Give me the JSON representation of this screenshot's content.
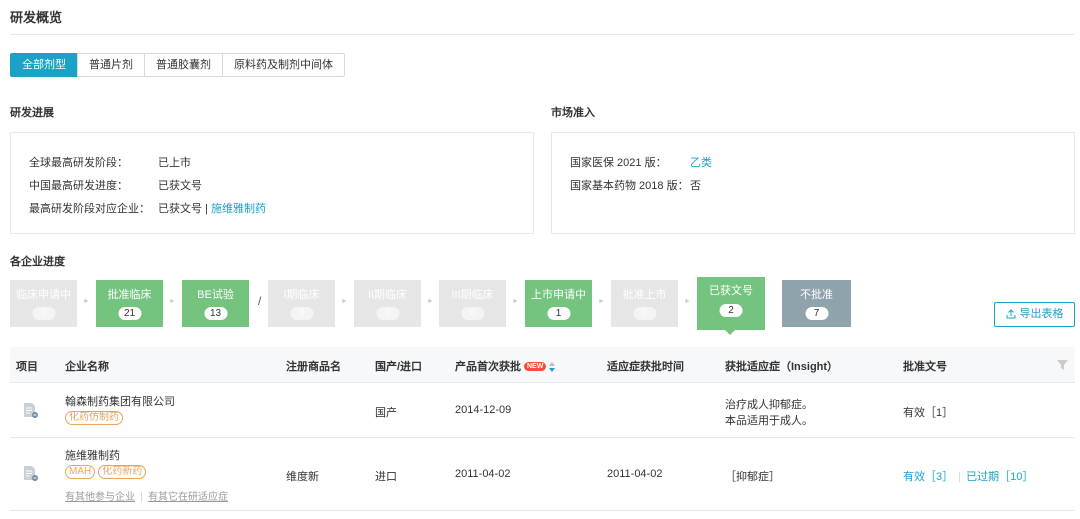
{
  "page": {
    "title": "研发概览"
  },
  "tabs": [
    {
      "label": "全部剂型",
      "active": true
    },
    {
      "label": "普通片剂",
      "active": false
    },
    {
      "label": "普通胶囊剂",
      "active": false
    },
    {
      "label": "原料药及制剂中间体",
      "active": false
    }
  ],
  "rd_progress": {
    "title": "研发进展",
    "rows": [
      {
        "key": "全球最高研发阶段：",
        "value": "已上市"
      },
      {
        "key": "中国最高研发进度：",
        "value": "已获文号"
      },
      {
        "key": "最高研发阶段对应企业：",
        "value": "已获文号 | ",
        "link": "施维雅制药"
      }
    ]
  },
  "market_access": {
    "title": "市场准入",
    "rows": [
      {
        "key": "国家医保 2021 版：",
        "value": "乙类"
      },
      {
        "key": "国家基本药物 2018 版：",
        "value": "否"
      }
    ]
  },
  "company_progress": {
    "title": "各企业进度",
    "stages": [
      {
        "label": "临床申请中",
        "count": "0",
        "style": "gray"
      },
      {
        "label": "批准临床",
        "count": "21",
        "style": "green"
      },
      {
        "label": "BE试验",
        "count": "13",
        "style": "green"
      },
      {
        "label": "I期临床",
        "count": "0",
        "style": "gray"
      },
      {
        "label": "II期临床",
        "count": "0",
        "style": "gray"
      },
      {
        "label": "III期临床",
        "count": "0",
        "style": "gray"
      },
      {
        "label": "上市申请中",
        "count": "1",
        "style": "green"
      },
      {
        "label": "批准上市",
        "count": "0",
        "style": "gray"
      },
      {
        "label": "已获文号",
        "count": "2",
        "style": "green"
      },
      {
        "label": "不批准",
        "count": "7",
        "style": "slate"
      }
    ],
    "separator": "/",
    "export_label": "导出表格"
  },
  "table": {
    "headers": {
      "item": "项目",
      "company": "企业名称",
      "brand": "注册商品名",
      "origin": "国产/进口",
      "first_approval": "产品首次获批",
      "new_badge": "NEW",
      "indication_date": "适应症获批时间",
      "indication": "获批适应症（Insight）",
      "approval_no": "批准文号"
    },
    "rows": [
      {
        "company": "翰森制药集团有限公司",
        "tags": [
          "化药仿制药"
        ],
        "brand": "",
        "origin": "国产",
        "first_approval": "2014-12-09",
        "indication_date": "",
        "indication_lines": [
          "治疗成人抑郁症。",
          "本品适用于成人。"
        ],
        "approval_valid": "有效［1］",
        "approval_expired": ""
      },
      {
        "company": "施维雅制药",
        "tags": [
          "MAH",
          "化药新药"
        ],
        "sub_links": [
          "有其他参与企业",
          "有其它在研适应症"
        ],
        "brand": "维度新",
        "origin": "进口",
        "first_approval": "2011-04-02",
        "indication_date": "2011-04-02",
        "indication_link": "［抑郁症］",
        "approval_valid": "有效［3］",
        "approval_expired": "已过期［10］"
      }
    ]
  },
  "colors": {
    "accent": "#1aa3c6",
    "stage_green": "#74c47f",
    "stage_gray": "#e6e6e6",
    "stage_slate": "#8fa3ad",
    "tag_orange": "#e8a55b"
  }
}
